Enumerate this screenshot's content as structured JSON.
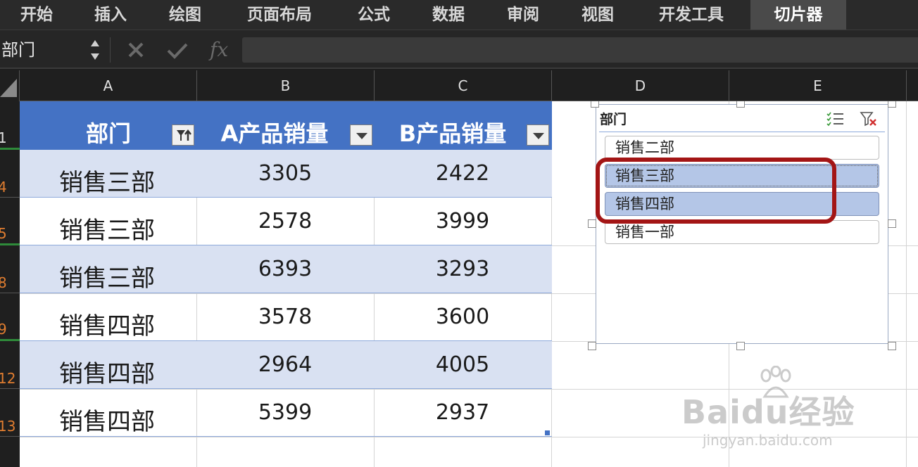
{
  "ribbon": {
    "tabs": [
      {
        "label": "开始",
        "active": false
      },
      {
        "label": "插入",
        "active": false
      },
      {
        "label": "绘图",
        "active": false
      },
      {
        "label": "页面布局",
        "active": false
      },
      {
        "label": "公式",
        "active": false
      },
      {
        "label": "数据",
        "active": false
      },
      {
        "label": "审阅",
        "active": false
      },
      {
        "label": "视图",
        "active": false
      },
      {
        "label": "开发工具",
        "active": false
      },
      {
        "label": "切片器",
        "active": true
      }
    ]
  },
  "formula_bar": {
    "name_box": "部门",
    "stepper_icon": "stepper-arrows-icon",
    "cancel_icon": "cancel-x-icon",
    "confirm_icon": "checkmark-icon",
    "fx_label": "fx",
    "formula": ""
  },
  "columns": [
    "A",
    "B",
    "C",
    "D",
    "E"
  ],
  "rows": [
    "1",
    "4",
    "5",
    "8",
    "9",
    "12",
    "13"
  ],
  "table": {
    "headers": [
      "部门",
      "A产品销量",
      "B产品销量"
    ],
    "filter_icons": [
      "filter-applied-icon",
      "dropdown-arrow-icon",
      "dropdown-arrow-icon"
    ],
    "rows": [
      {
        "dept": "销售三部",
        "a": "3305",
        "b": "2422"
      },
      {
        "dept": "销售三部",
        "a": "2578",
        "b": "3999"
      },
      {
        "dept": "销售三部",
        "a": "6393",
        "b": "3293"
      },
      {
        "dept": "销售四部",
        "a": "3578",
        "b": "3600"
      },
      {
        "dept": "销售四部",
        "a": "2964",
        "b": "4005"
      },
      {
        "dept": "销售四部",
        "a": "5399",
        "b": "2937"
      }
    ],
    "header_color": "#4472c4",
    "band_color": "#d9e1f2"
  },
  "slicer": {
    "title": "部门",
    "multiselect_icon": "multi-select-icon",
    "clear_filter_icon": "clear-filter-icon",
    "items": [
      {
        "label": "销售二部",
        "selected": false
      },
      {
        "label": "销售三部",
        "selected": true
      },
      {
        "label": "销售四部",
        "selected": true
      },
      {
        "label": "销售一部",
        "selected": false
      }
    ],
    "selected_color": "#b4c6e7"
  },
  "annotation_color": "#a31515",
  "watermark": {
    "main": "Baidu经验",
    "sub": "jingyan.baidu.com"
  }
}
